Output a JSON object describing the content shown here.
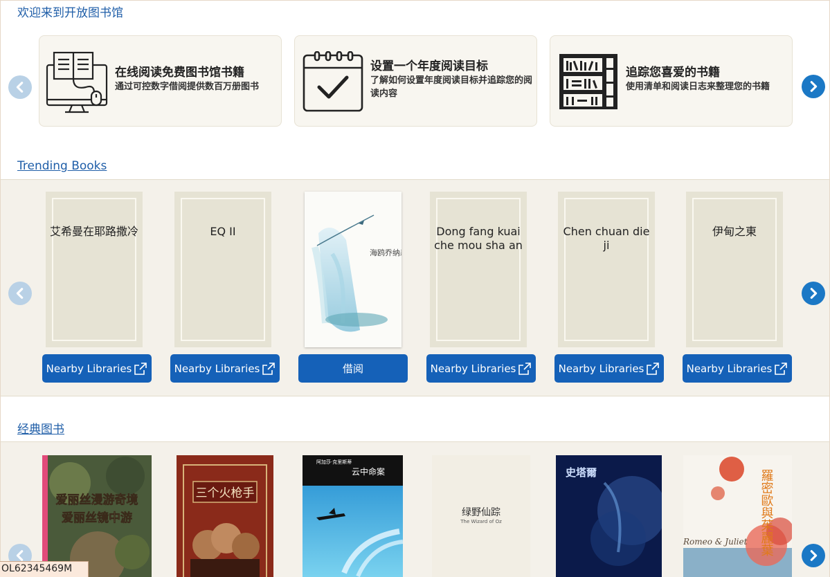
{
  "welcome": {
    "title": "欢迎来到开放图书馆"
  },
  "promos": [
    {
      "heading": "在线阅读免费图书馆书籍",
      "sub": "通过可控数字借阅提供数百万册图书",
      "icon": "computer-library-icon"
    },
    {
      "heading": "设置一个年度阅读目标",
      "sub": "了解如何设置年度阅读目标并追踪您的阅读内容",
      "icon": "calendar-check-icon"
    },
    {
      "heading": "追踪您喜爱的书籍",
      "sub": "使用清单和阅读日志来整理您的书籍",
      "icon": "bookshelf-icon"
    }
  ],
  "trending": {
    "title": "Trending Books",
    "books": [
      {
        "title": "艾希曼在耶路撒冷",
        "button": "Nearby Libraries"
      },
      {
        "title": "EQ II",
        "button": "Nearby Libraries"
      },
      {
        "title": "海鸥乔纳森",
        "button": "借阅"
      },
      {
        "title": "Dong fang kuai che mou sha an",
        "button": "Nearby Libraries"
      },
      {
        "title": "Chen chuan die ji",
        "button": "Nearby Libraries"
      },
      {
        "title": "伊甸之東",
        "button": "Nearby Libraries"
      }
    ]
  },
  "classics": {
    "title": "经典图书",
    "books": [
      {
        "title": "爱丽丝漫游奇境 爱丽丝镜中游"
      },
      {
        "title": "三个火枪手"
      },
      {
        "title": "云中命案"
      },
      {
        "title": "绿野仙踪",
        "subtitle": "The Wizard of Oz"
      },
      {
        "title": "史塔爾"
      },
      {
        "title": "羅密歐與茱麗葉",
        "subtitle": "Romeo & Juliet"
      }
    ]
  },
  "badge": {
    "text": "OL62345469M"
  },
  "colors": {
    "accent": "#1561b8",
    "link": "#1f5ea8",
    "band": "#f4f1ea"
  }
}
